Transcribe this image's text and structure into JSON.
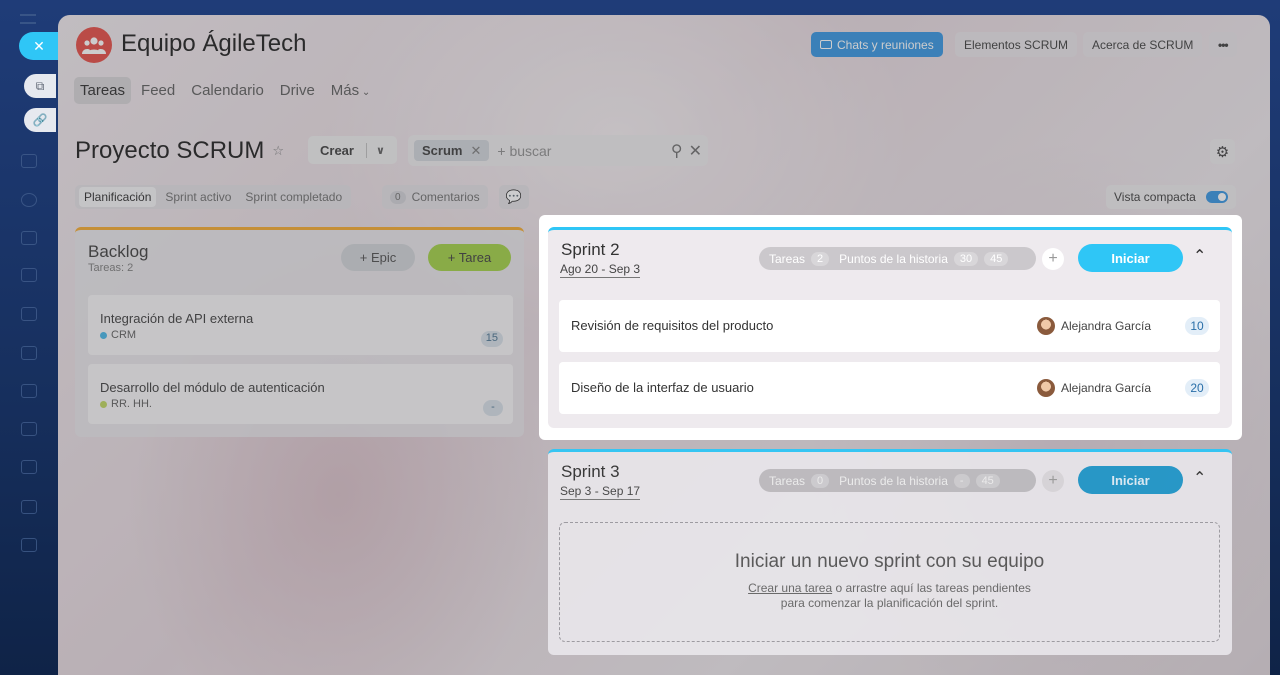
{
  "team": {
    "title": "Equipo ÁgileTech"
  },
  "header_buttons": {
    "chats": "Chats y reuniones",
    "elements": "Elementos SCRUM",
    "about": "Acerca de SCRUM",
    "more": "•••"
  },
  "tabs": [
    "Tareas",
    "Feed",
    "Calendario",
    "Drive",
    "Más"
  ],
  "project": {
    "title": "Proyecto SCRUM"
  },
  "toolbar": {
    "create": "Crear",
    "filter_chip": "Scrum",
    "search_placeholder": "+ buscar"
  },
  "subtabs": [
    "Planificación",
    "Sprint activo",
    "Sprint completado"
  ],
  "comments": {
    "count": "0",
    "label": "Comentarios"
  },
  "compact_view": {
    "label": "Vista compacta",
    "enabled": true
  },
  "backlog": {
    "title": "Backlog",
    "subtitle": "Tareas: 2",
    "epic_btn": "+ Epic",
    "task_btn": "+ Tarea",
    "items": [
      {
        "name": "Integración de API externa",
        "epic": "CRM",
        "epic_color": "#3bb3e6",
        "points": "15"
      },
      {
        "name": "Desarrollo del módulo de autenticación",
        "epic": "RR. HH.",
        "epic_color": "#bbd554",
        "points": "-"
      }
    ]
  },
  "sprints": [
    {
      "title": "Sprint 2",
      "dates": "Ago 20 - Sep 3",
      "tasks_label": "Tareas",
      "tasks_count": "2",
      "points_label": "Puntos de la historia",
      "points_done": "30",
      "points_total": "45",
      "start_btn": "Iniciar",
      "items": [
        {
          "name": "Revisión de requisitos del producto",
          "assignee": "Alejandra García",
          "points": "10"
        },
        {
          "name": "Diseño de la interfaz de usuario",
          "assignee": "Alejandra García",
          "points": "20"
        }
      ]
    },
    {
      "title": "Sprint 3",
      "dates": "Sep 3 - Sep 17",
      "tasks_label": "Tareas",
      "tasks_count": "0",
      "points_label": "Puntos de la historia",
      "points_done": "-",
      "points_total": "45",
      "start_btn": "Iniciar",
      "empty": {
        "heading": "Iniciar un nuevo sprint con su equipo",
        "link": "Crear una tarea",
        "text1": " o arrastre aquí las tareas pendientes",
        "text2": "para comenzar la planificación del sprint."
      }
    }
  ]
}
